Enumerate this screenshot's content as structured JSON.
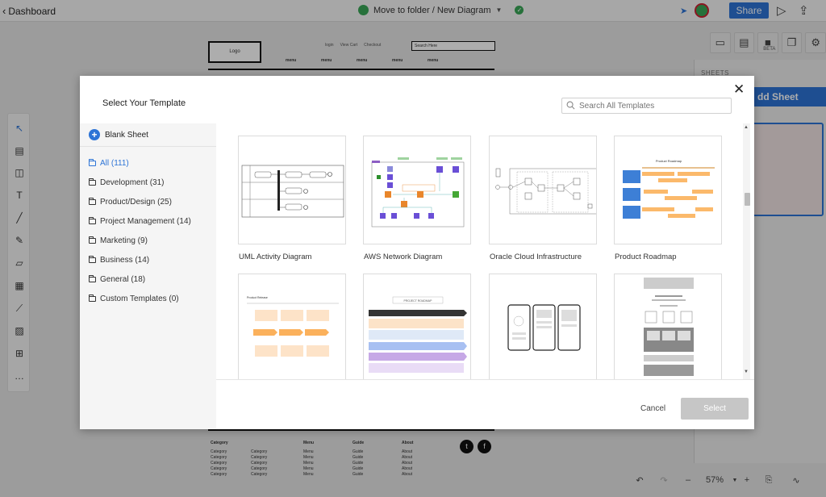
{
  "topbar": {
    "back_label": "Dashboard",
    "breadcrumb": "Move to folder / New Diagram",
    "share_label": "Share"
  },
  "right_panel": {
    "beta_label": "BETA",
    "sheets_label": "SHEETS",
    "add_sheet_label": "dd Sheet"
  },
  "wireframe": {
    "logo": "Logo",
    "options": [
      "login",
      "View Cart",
      "Checkout"
    ],
    "search_placeholder": "Search Here",
    "menu_items": [
      "menu",
      "menu",
      "menu",
      "menu",
      "menu"
    ],
    "footer_columns": [
      {
        "heading": "Category",
        "items": [
          "Category",
          "Category",
          "Category",
          "Category",
          "Category"
        ]
      },
      {
        "heading": "",
        "items": [
          "Category",
          "Category",
          "Category",
          "Category",
          "Category"
        ]
      },
      {
        "heading": "Menu",
        "items": [
          "Menu",
          "Menu",
          "Menu",
          "Menu",
          "Menu"
        ]
      },
      {
        "heading": "Guide",
        "items": [
          "Guide",
          "Guide",
          "Guide",
          "Guide",
          "Guide"
        ]
      },
      {
        "heading": "About",
        "items": [
          "About",
          "About",
          "About",
          "About",
          "About"
        ]
      }
    ]
  },
  "zoom": {
    "level": "57%"
  },
  "modal": {
    "title": "Select Your Template",
    "search_placeholder": "Search All Templates",
    "blank_sheet": "Blank Sheet",
    "categories": [
      {
        "label": "All (111)"
      },
      {
        "label": "Development (31)"
      },
      {
        "label": "Product/Design (25)"
      },
      {
        "label": "Project Management (14)"
      },
      {
        "label": "Marketing (9)"
      },
      {
        "label": "Business (14)"
      },
      {
        "label": "General (18)"
      },
      {
        "label": "Custom Templates (0)"
      }
    ],
    "templates": [
      {
        "label": "UML Activity Diagram"
      },
      {
        "label": "AWS Network Diagram"
      },
      {
        "label": "Oracle Cloud Infrastructure"
      },
      {
        "label": "Product Roadmap"
      },
      {
        "label": ""
      },
      {
        "label": ""
      },
      {
        "label": ""
      },
      {
        "label": ""
      }
    ],
    "thumb_text": {
      "product_roadmap": "Product Roadmap",
      "product_roadmap_2": "PROJECT ROADMAP",
      "timeline": "Product Release"
    },
    "cancel_label": "Cancel",
    "select_label": "Select"
  },
  "colors": {
    "accent": "#2d74d6",
    "select_disabled": "#c6c6c6"
  }
}
